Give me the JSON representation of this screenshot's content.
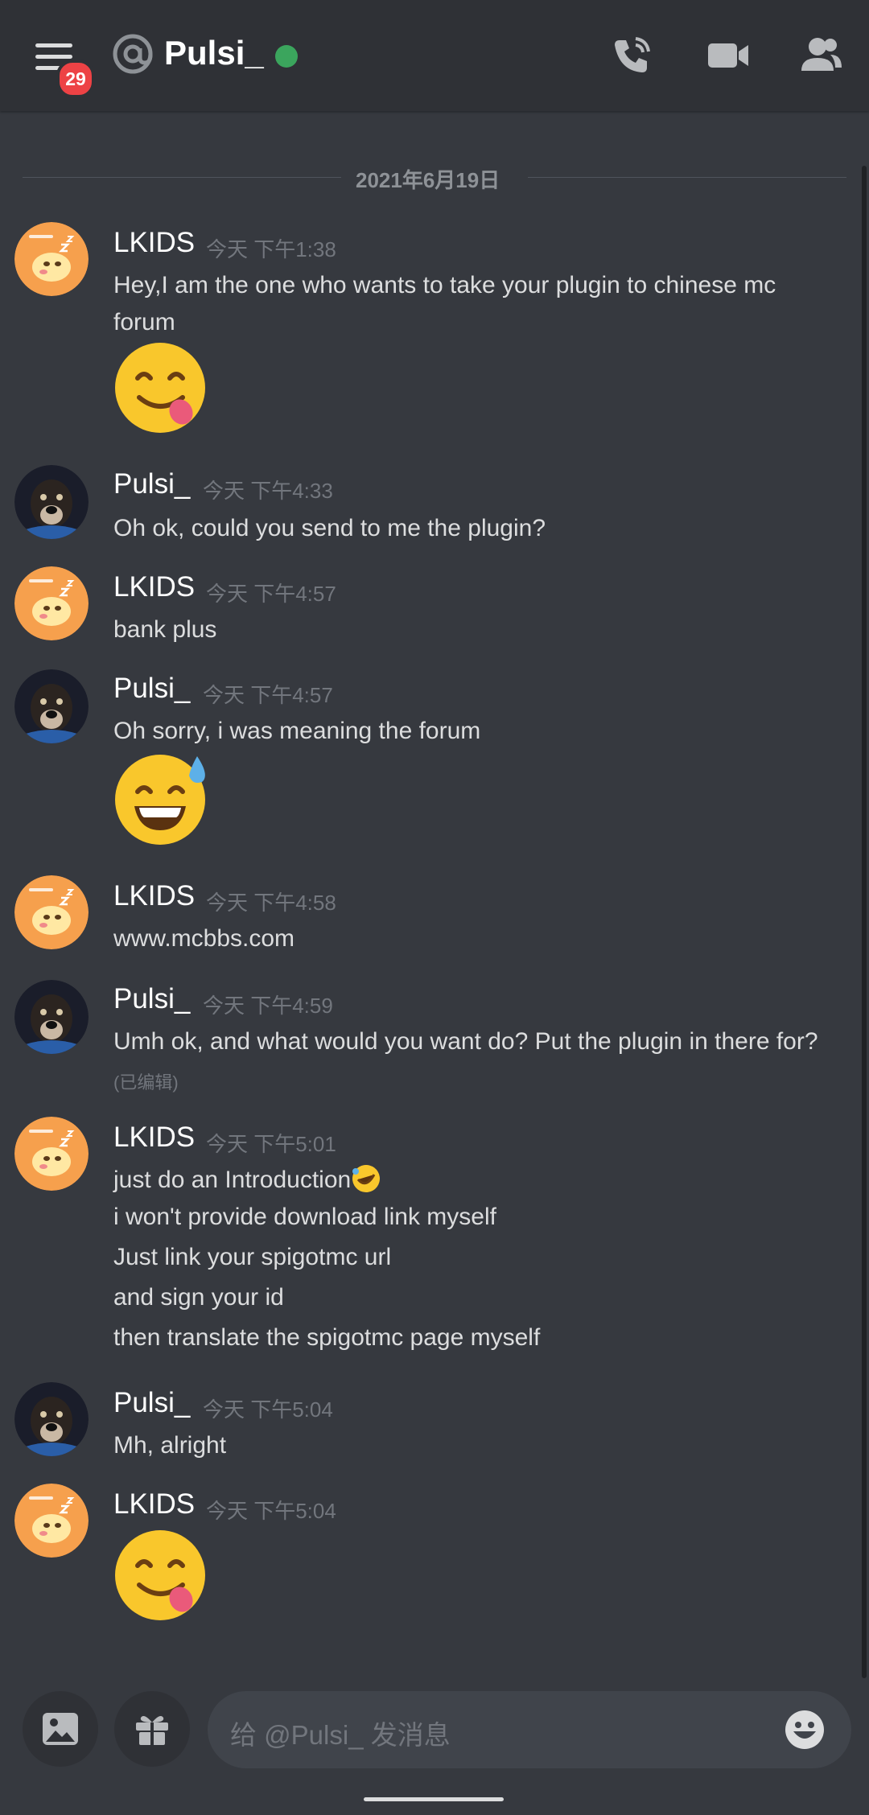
{
  "header": {
    "unread_badge": "29",
    "channel_title": "Pulsi_"
  },
  "date_divider": "2021年6月19日",
  "messages": [
    {
      "author": "LKIDS",
      "time": "今天 下午1:38",
      "lines": [
        "Hey,I am the one who wants to take your plugin to chinese mc",
        "forum"
      ]
    },
    {
      "author": "Pulsi_",
      "time": "今天 下午4:33",
      "lines": [
        "Oh ok, could you send to me the plugin?"
      ]
    },
    {
      "author": "LKIDS",
      "time": "今天 下午4:57",
      "lines": [
        "bank plus"
      ]
    },
    {
      "author": "Pulsi_",
      "time": "今天 下午4:57",
      "lines": [
        "Oh sorry, i was meaning the forum"
      ]
    },
    {
      "author": "LKIDS",
      "time": "今天 下午4:58",
      "lines": [
        "www.mcbbs.com"
      ]
    },
    {
      "author": "Pulsi_",
      "time": "今天 下午4:59",
      "lines": [
        "Umh ok, and what would you want do? Put the plugin in there for?"
      ],
      "edited": "(已编辑)"
    },
    {
      "author": "LKIDS",
      "time": "今天 下午5:01",
      "lines": [
        "just do an Introduction",
        "i won't provide download link myself",
        "Just link your spigotmc url",
        "and sign your id",
        "then translate the spigotmc page myself"
      ]
    },
    {
      "author": "Pulsi_",
      "time": "今天 下午5:04",
      "lines": [
        "Mh, alright"
      ]
    },
    {
      "author": "LKIDS",
      "time": "今天 下午5:04",
      "lines": []
    }
  ],
  "composer": {
    "placeholder": "给 @Pulsi_ 发消息"
  },
  "icons": {
    "menu": "hamburger-menu-icon",
    "at": "at-sign-icon",
    "call": "phone-call-icon",
    "video": "video-camera-icon",
    "members": "members-icon",
    "image": "image-icon",
    "gift": "gift-icon",
    "emoji": "emoji-icon"
  },
  "colors": {
    "background": "#36393f",
    "header": "#2f3136",
    "online": "#3ba55d",
    "badge": "#ed4245"
  }
}
